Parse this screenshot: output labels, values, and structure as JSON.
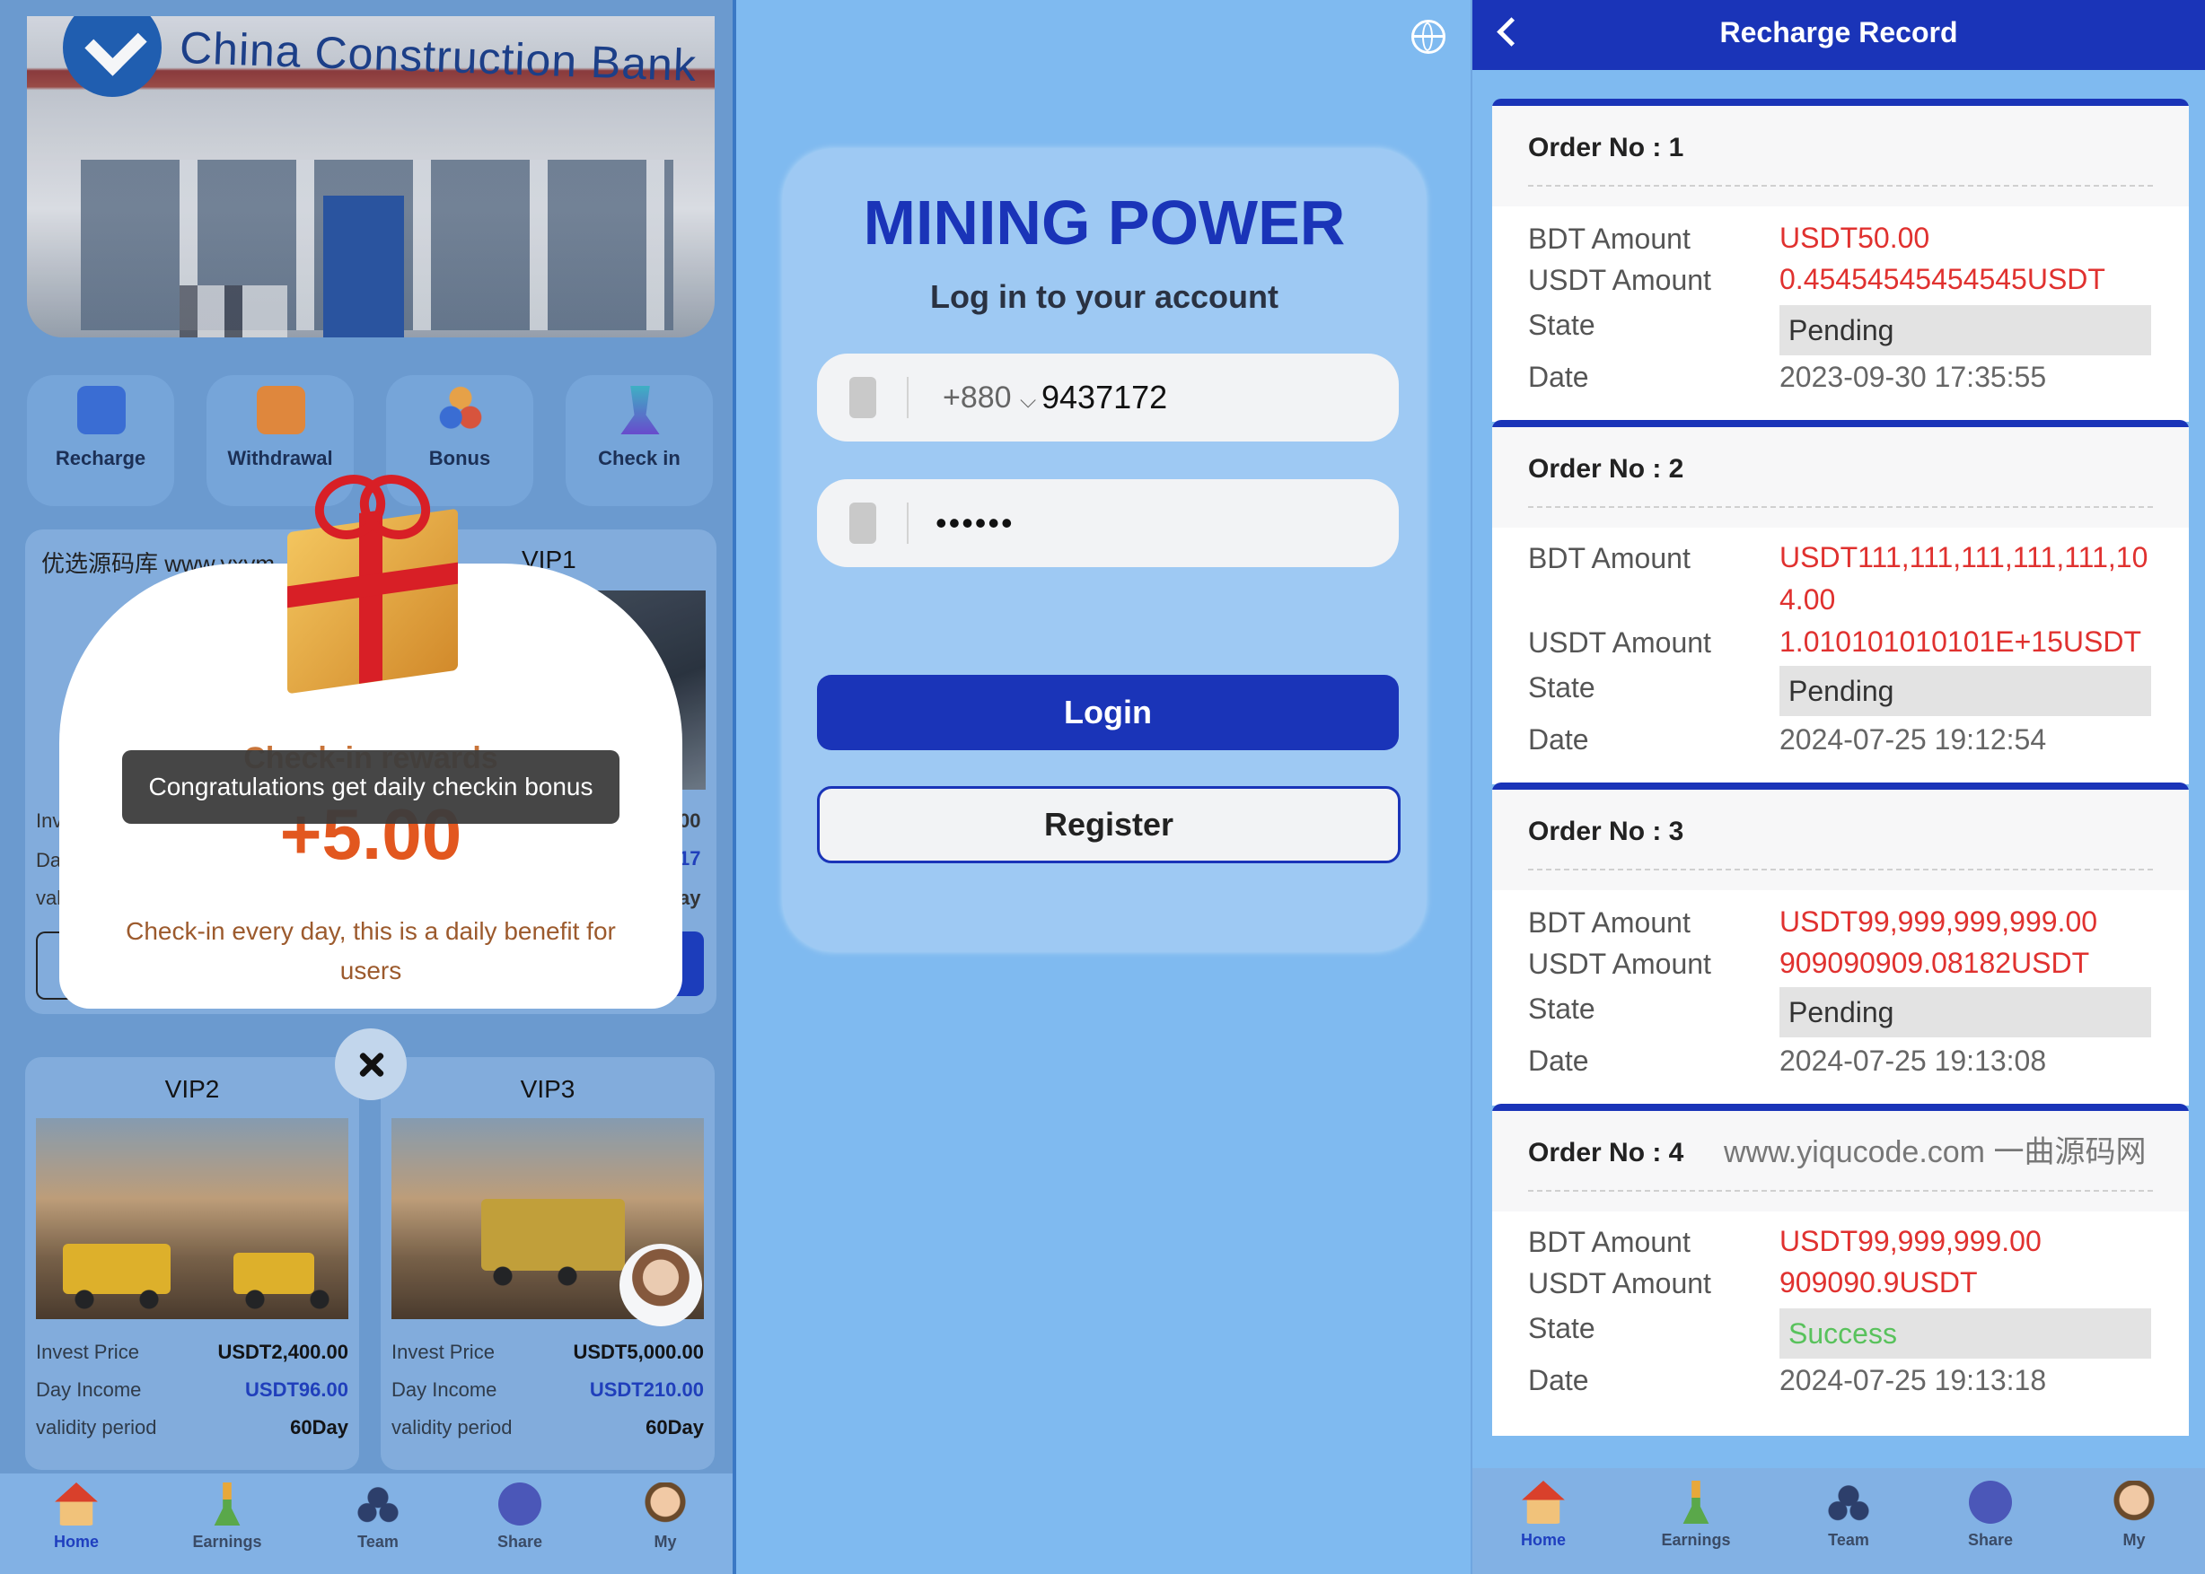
{
  "home": {
    "bank_name": "China Construction Bank",
    "quick_actions": [
      {
        "label": "Recharge",
        "icon": "wallet-icon",
        "color": "#3a6fd8"
      },
      {
        "label": "Withdrawal",
        "icon": "card-icon",
        "color": "#e88b3a"
      },
      {
        "label": "Bonus",
        "icon": "people-icon",
        "color": "#f0a646"
      },
      {
        "label": "Check in",
        "icon": "trophy-icon",
        "color": "#3fb6c9"
      }
    ],
    "vip1": {
      "source_text": "优选源码库 www.yxym",
      "title": "VIP1",
      "side_values": [
        "00",
        "17",
        "ay"
      ],
      "side_labels": [
        "Inv",
        "Da",
        "val"
      ]
    },
    "popup": {
      "title": "Check-in rewards",
      "amount": "+5.00",
      "description": "Check-in every day, this is a daily benefit for users",
      "toast": "Congratulations get daily checkin bonus"
    },
    "vip_cards": [
      {
        "title": "VIP2",
        "invest_label": "Invest Price",
        "invest": "USDT2,400.00",
        "income_label": "Day Income",
        "income": "USDT96.00",
        "validity_label": "validity period",
        "validity": "60Day"
      },
      {
        "title": "VIP3",
        "invest_label": "Invest Price",
        "invest": "USDT5,000.00",
        "income_label": "Day Income",
        "income": "USDT210.00",
        "validity_label": "validity period",
        "validity": "60Day"
      }
    ],
    "nav": [
      {
        "label": "Home",
        "icon": "house-icon",
        "active": true
      },
      {
        "label": "Earnings",
        "icon": "plant-icon",
        "active": false
      },
      {
        "label": "Team",
        "icon": "team-icon",
        "active": false
      },
      {
        "label": "Share",
        "icon": "share-icon",
        "active": false
      },
      {
        "label": "My",
        "icon": "person-icon",
        "active": false
      }
    ]
  },
  "login": {
    "title": "MINING POWER",
    "subtitle": "Log in to your account",
    "country_code": "+880",
    "phone_value": "9437172",
    "password_mask": "••••••",
    "login_label": "Login",
    "register_label": "Register"
  },
  "records": {
    "title": "Recharge Record",
    "labels": {
      "bdt": "BDT Amount",
      "usdt": "USDT Amount",
      "state": "State",
      "date": "Date"
    },
    "orders": [
      {
        "no": "Order No : 1",
        "bdt": "USDT50.00",
        "usdt": "0.45454545454545USDT",
        "state": "Pending",
        "date": "2023-09-30 17:35:55"
      },
      {
        "no": "Order No : 2",
        "bdt": "USDT111,111,111,111,111,104.00",
        "usdt": "1.010101010101E+15USDT",
        "state": "Pending",
        "date": "2024-07-25 19:12:54"
      },
      {
        "no": "Order No : 3",
        "bdt": "USDT99,999,999,999.00",
        "usdt": "909090909.08182USDT",
        "state": "Pending",
        "date": "2024-07-25 19:13:08"
      },
      {
        "no": "Order No : 4",
        "bdt": "USDT99,999,999.00",
        "usdt": "909090.9USDT",
        "state": "Success",
        "date": "2024-07-25 19:13:18"
      }
    ],
    "watermark": "www.yiqucode.com 一曲源码网",
    "nav": [
      {
        "label": "Home",
        "active": true
      },
      {
        "label": "Earnings",
        "active": false
      },
      {
        "label": "Team",
        "active": false
      },
      {
        "label": "Share",
        "active": false
      },
      {
        "label": "My",
        "active": false
      }
    ]
  },
  "colors": {
    "primary": "#1a34b8",
    "danger": "#e0312f",
    "success": "#59c25c",
    "popup_amount": "#e2571f"
  }
}
